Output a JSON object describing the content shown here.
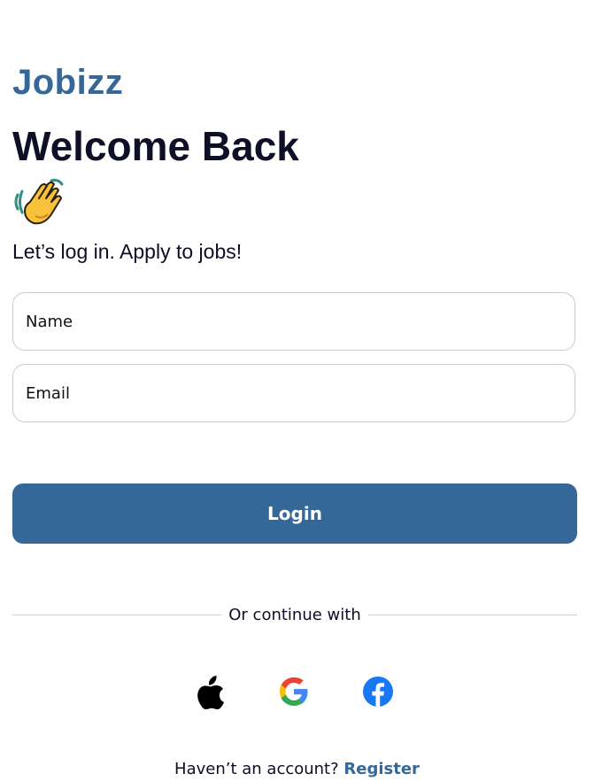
{
  "brand": "Jobizz",
  "welcome": {
    "title": "Welcome Back",
    "emoji_icon": "waving-hand-icon",
    "tagline": "Let’s log in. Apply to jobs!"
  },
  "form": {
    "name_placeholder": "Name",
    "name_value": "",
    "email_placeholder": "Email",
    "email_value": "",
    "login_label": "Login"
  },
  "social": {
    "divider_text": "Or continue with",
    "providers": [
      {
        "name": "Apple",
        "icon": "apple-icon"
      },
      {
        "name": "Google",
        "icon": "google-icon"
      },
      {
        "name": "Facebook",
        "icon": "facebook-icon"
      }
    ]
  },
  "footer": {
    "prompt": "Haven’t an account?",
    "register_label": "Register"
  },
  "colors": {
    "accent": "#356899",
    "text_dark": "#0D1026",
    "border": "#C9C9CF",
    "facebook_blue": "#1877F2"
  }
}
